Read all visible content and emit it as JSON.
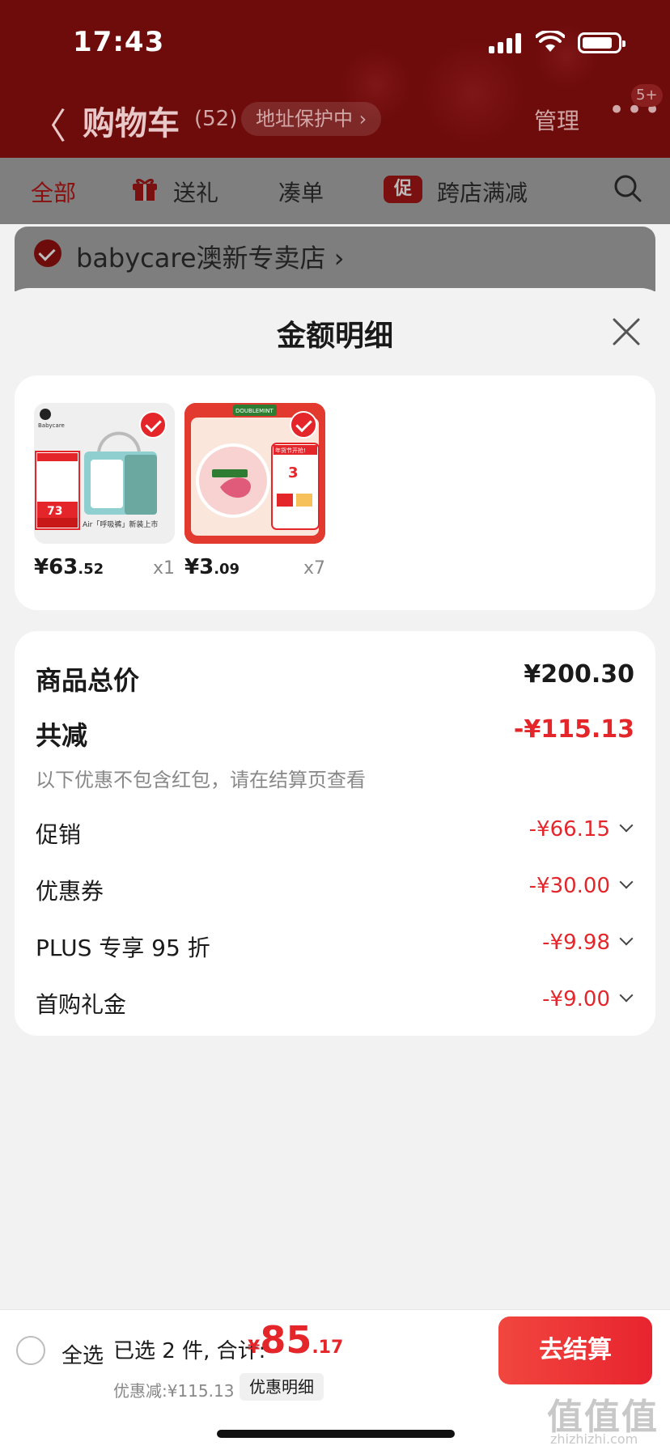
{
  "status_bar": {
    "time": "17:43"
  },
  "nav": {
    "back_label": "〈",
    "title": "购物车",
    "count": "(52)",
    "address_protect": "地址保护中 ›",
    "manage": "管理",
    "more": "•••",
    "badge": "5+"
  },
  "filters": {
    "all": "全部",
    "gift": "送礼",
    "combine": "凑单",
    "promo_tag": "促",
    "cross_store": "跨店满减"
  },
  "store": {
    "name": "babycare澳新专卖店 ›"
  },
  "sheet": {
    "title": "金额明细",
    "goods": [
      {
        "price_main": "¥63",
        "price_dec": ".52",
        "qty": "x1",
        "thumb_text": "Air「呼吸裤」新装上市",
        "thumb_badge": "73",
        "thumb_brand": "Babycare"
      },
      {
        "price_main": "¥3",
        "price_dec": ".09",
        "qty": "x7",
        "thumb_text": "年货节开抢!",
        "thumb_badge": "3",
        "thumb_brand": "DOUBLEMINT"
      }
    ],
    "total": {
      "label": "商品总价",
      "value": "¥200.30"
    },
    "reduce": {
      "label": "共减",
      "value": "-¥115.13"
    },
    "note": "以下优惠不包含红包，请在结算页查看",
    "items": [
      {
        "label": "促销",
        "value": "-¥66.15"
      },
      {
        "label": "优惠券",
        "value": "-¥30.00"
      },
      {
        "label": "PLUS 专享 95 折",
        "value": "-¥9.98"
      },
      {
        "label": "首购礼金",
        "value": "-¥9.00"
      }
    ]
  },
  "checkout_bar": {
    "select_all": "全选",
    "summary": "已选 2 件, 合计:",
    "amount_yen": "¥",
    "amount_main": "85",
    "amount_dec": ".17",
    "saved": "优惠减:¥115.13",
    "detail_link": "优惠明细",
    "checkout_button": "去结算"
  },
  "watermark": {
    "main": "值值值",
    "sub": "zhizhizhi.com"
  },
  "colors": {
    "accent_red": "#e4262b",
    "header_dark": "#6e0b0b"
  }
}
